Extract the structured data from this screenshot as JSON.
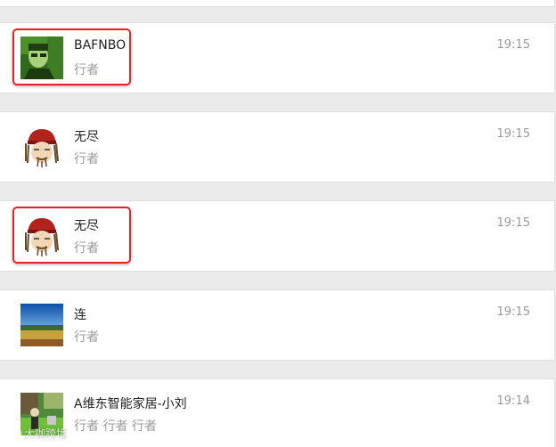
{
  "messages": [
    {
      "name": "BAFNBO",
      "role": "行者",
      "time": "19:15",
      "avatar": "avatar-photo-green",
      "highlighted": true
    },
    {
      "name": "无尽",
      "role": "行者",
      "time": "19:15",
      "avatar": "avatar-pirate-cartoon",
      "highlighted": false
    },
    {
      "name": "无尽",
      "role": "行者",
      "time": "19:15",
      "avatar": "avatar-pirate-cartoon",
      "highlighted": true
    },
    {
      "name": "连",
      "role": "行者",
      "time": "19:15",
      "avatar": "avatar-landscape",
      "highlighted": false
    },
    {
      "name": "A维东智能家居-小刘",
      "role": "行者 行者 行者",
      "time": "19:14",
      "avatar": "avatar-garden-photo",
      "highlighted": false
    }
  ],
  "watermark": {
    "text": "大咖跨境"
  },
  "colors": {
    "highlight_border": "#e0242a",
    "background": "#ebebeb",
    "card": "#ffffff",
    "secondary_text": "#9a9a9a"
  }
}
